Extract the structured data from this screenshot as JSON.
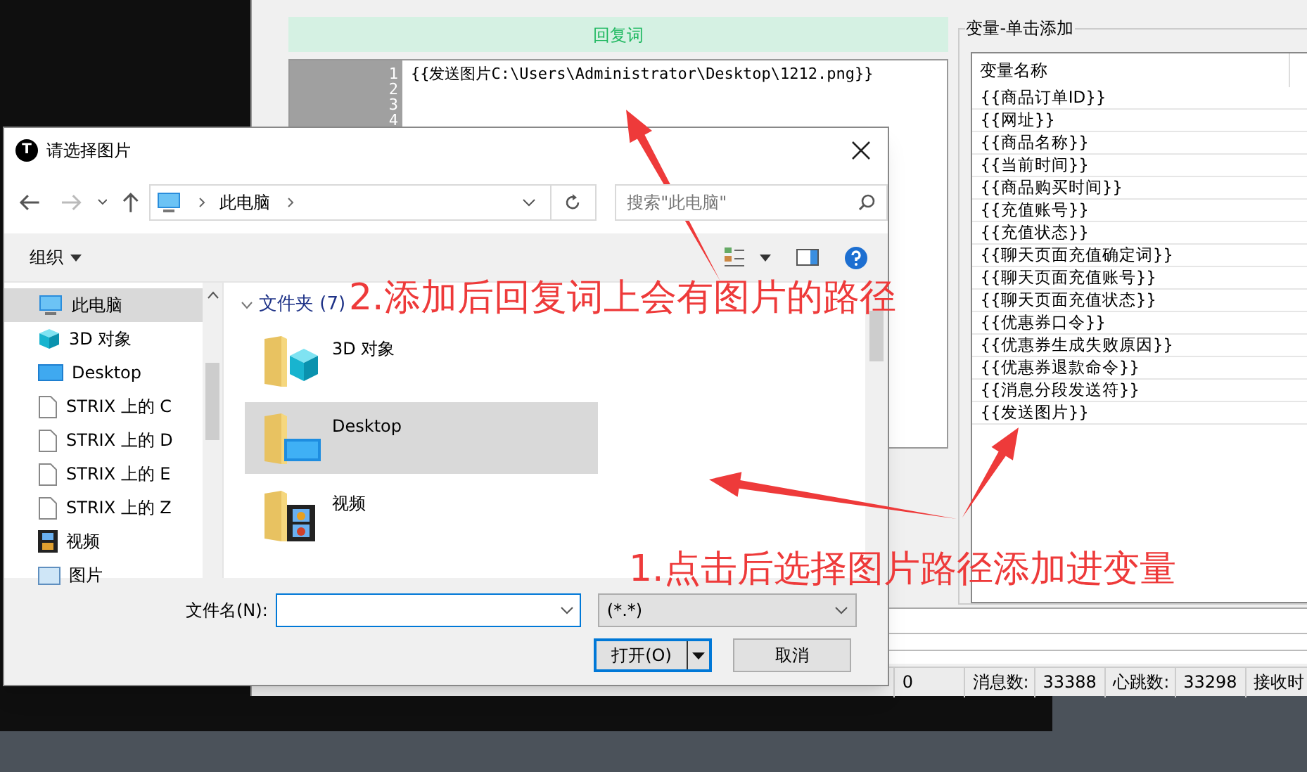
{
  "main_window": {
    "editor": {
      "header": "回复词",
      "line_numbers": [
        "1",
        "2",
        "3",
        "4"
      ],
      "lines": [
        "{{发送图片C:\\Users\\Administrator\\Desktop\\1212.png}}"
      ]
    },
    "variables": {
      "group_title": "变量-单击添加",
      "column": "变量名称",
      "items": [
        {
          "label": "{{商品订单ID}}"
        },
        {
          "label": "{{网址}}"
        },
        {
          "label": "{{商品名称}}"
        },
        {
          "label": "{{当前时间}}"
        },
        {
          "label": "{{商品购买时间}}"
        },
        {
          "label": "{{充值账号}}"
        },
        {
          "label": "{{充值状态}}"
        },
        {
          "label": "{{聊天页面充值确定词}}"
        },
        {
          "label": "{{聊天页面充值账号}}"
        },
        {
          "label": "{{聊天页面充值状态}}"
        },
        {
          "label": "{{优惠券口令}}"
        },
        {
          "label": "{{优惠券生成失败原因}}"
        },
        {
          "label": "{{优惠券退款命令}}"
        },
        {
          "label": "{{消息分段发送符}}"
        },
        {
          "label": "{{发送图片}}"
        }
      ]
    },
    "status_bar": [
      "0",
      "消息数:",
      "33388",
      "心跳数:",
      "33298",
      "接收时"
    ]
  },
  "dialog": {
    "app_icon_letter": "T",
    "title": "请选择图片",
    "address": {
      "location": "此电脑"
    },
    "search": {
      "placeholder": "搜索\"此电脑\""
    },
    "toolbar": {
      "organize": "组织"
    },
    "nav_items": [
      {
        "label": "此电脑",
        "kind": "pc",
        "selected": true
      },
      {
        "label": "3D 对象",
        "kind": "cube",
        "selected": false
      },
      {
        "label": "Desktop",
        "kind": "desktop",
        "selected": false
      },
      {
        "label": "STRIX 上的 C",
        "kind": "drive",
        "selected": false
      },
      {
        "label": "STRIX 上的 D",
        "kind": "drive",
        "selected": false
      },
      {
        "label": "STRIX 上的 E",
        "kind": "drive",
        "selected": false
      },
      {
        "label": "STRIX 上的 Z",
        "kind": "drive",
        "selected": false
      },
      {
        "label": "视频",
        "kind": "video",
        "selected": false
      },
      {
        "label": "图片",
        "kind": "image",
        "selected": false
      }
    ],
    "group_header": "文件夹 (7)",
    "folders": [
      {
        "label": "3D 对象",
        "kind": "cube",
        "selected": false
      },
      {
        "label": "Desktop",
        "kind": "desktop",
        "selected": true
      },
      {
        "label": "视频",
        "kind": "video",
        "selected": false
      }
    ],
    "filename_label": "文件名(N):",
    "filter": "(*.*)",
    "buttons": [
      {
        "label": "打开(O)",
        "kind": "split"
      },
      {
        "label": "取消",
        "kind": "plain"
      }
    ]
  },
  "annotations": [
    "2.添加后回复词上会有图片的路径",
    "1.点击后选择图片路径添加进变量"
  ]
}
